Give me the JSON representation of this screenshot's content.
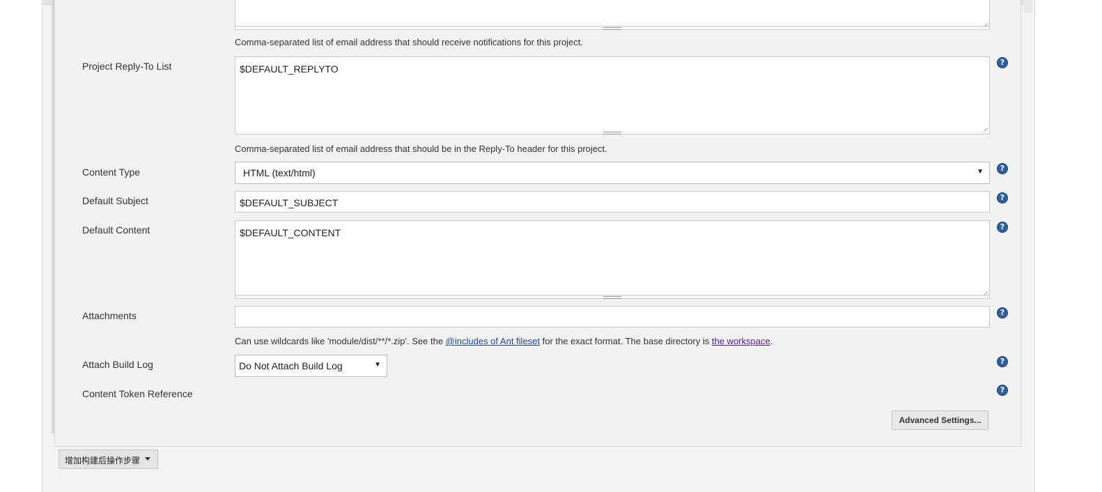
{
  "recipients": {
    "description": "Comma-separated list of email address that should receive notifications for this project."
  },
  "reply_to": {
    "label": "Project Reply-To List",
    "value": "$DEFAULT_REPLYTO",
    "description": "Comma-separated list of email address that should be in the Reply-To header for this project."
  },
  "content_type": {
    "label": "Content Type",
    "selected": "HTML (text/html)"
  },
  "default_subject": {
    "label": "Default Subject",
    "value": "$DEFAULT_SUBJECT"
  },
  "default_content": {
    "label": "Default Content",
    "value": "$DEFAULT_CONTENT"
  },
  "attachments": {
    "label": "Attachments",
    "value": "",
    "desc_prefix": "Can use wildcards like 'module/dist/**/*.zip'. See the ",
    "desc_link1": "@includes of Ant fileset",
    "desc_middle": " for the exact format. The base directory is ",
    "desc_link2": "the workspace",
    "desc_suffix": "."
  },
  "attach_build_log": {
    "label": "Attach Build Log",
    "selected": "Do Not Attach Build Log"
  },
  "content_token_reference": {
    "label": "Content Token Reference"
  },
  "help_icon_glyph": "?",
  "advanced_settings_button": "Advanced Settings...",
  "add_post_build_step_button": "增加构建后操作步骤",
  "colors": {
    "help_icon": "#2e5f9e",
    "link": "#204a87",
    "visited_link": "#551a8b",
    "panel_background": "#f2f2f2"
  }
}
